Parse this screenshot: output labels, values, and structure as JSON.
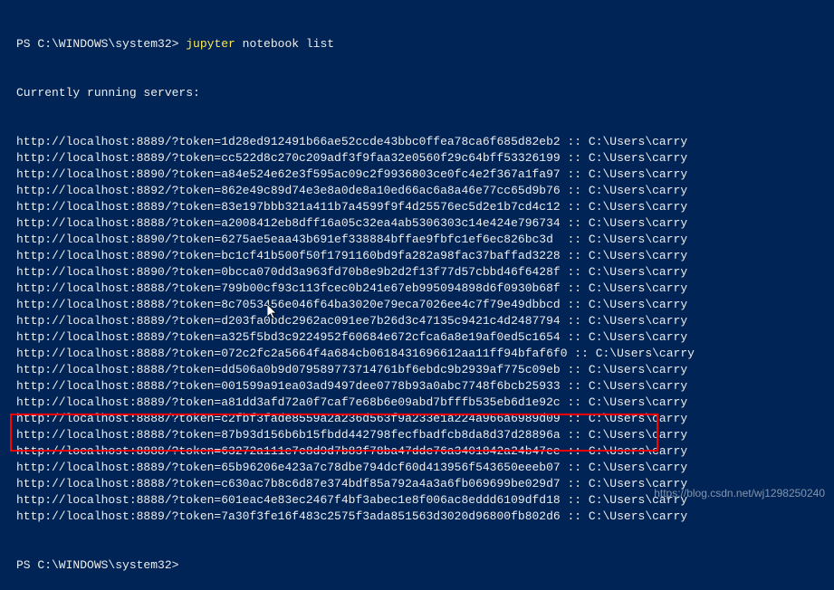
{
  "prompt": {
    "prefix": "PS C:\\WINDOWS\\system32> ",
    "command_name": "jupyter",
    "command_args": " notebook list"
  },
  "header": "Currently running servers:",
  "servers": [
    {
      "port": "8889",
      "token": "1d28ed912491b66ae52ccde43bbc0ffea78ca6f685d82eb2",
      "path": "C:\\Users\\carry"
    },
    {
      "port": "8889",
      "token": "cc522d8c270c209adf3f9faa32e0560f29c64bff53326199",
      "path": "C:\\Users\\carry"
    },
    {
      "port": "8890",
      "token": "a84e524e62e3f595ac09c2f9936803ce0fc4e2f367a1fa97",
      "path": "C:\\Users\\carry"
    },
    {
      "port": "8892",
      "token": "862e49c89d74e3e8a0de8a10ed66ac6a8a46e77cc65d9b76",
      "path": "C:\\Users\\carry"
    },
    {
      "port": "8889",
      "token": "83e197bbb321a411b7a4599f9f4d25576ec5d2e1b7cd4c12",
      "path": "C:\\Users\\carry"
    },
    {
      "port": "8888",
      "token": "a2008412eb8dff16a05c32ea4ab5306303c14e424e796734",
      "path": "C:\\Users\\carry"
    },
    {
      "port": "8890",
      "token": "6275ae5eaa43b691ef338884bffae9fbfc1ef6ec826bc3d ",
      "path": "C:\\Users\\carry"
    },
    {
      "port": "8890",
      "token": "bc1cf41b500f50f1791160bd9fa282a98fac37baffad3228",
      "path": "C:\\Users\\carry"
    },
    {
      "port": "8890",
      "token": "0bcca070dd3a963fd70b8e9b2d2f13f77d57cbbd46f6428f",
      "path": "C:\\Users\\carry"
    },
    {
      "port": "8888",
      "token": "799b00cf93c113fcec0b241e67eb995094898d6f0930b68f",
      "path": "C:\\Users\\carry"
    },
    {
      "port": "8888",
      "token": "8c7053456e046f64ba3020e79eca7026ee4c7f79e49dbbcd",
      "path": "C:\\Users\\carry"
    },
    {
      "port": "8889",
      "token": "d203fa0bdc2962ac091ee7b26d3c47135c9421c4d2487794",
      "path": "C:\\Users\\carry"
    },
    {
      "port": "8889",
      "token": "a325f5bd3c9224952f60684e672cfca6a8e19af0ed5c1654",
      "path": "C:\\Users\\carry"
    },
    {
      "port": "8888",
      "token": "072c2fc2a5664f4a684cb0618431696612aa11ff94bfaf6f0",
      "path": "C:\\Users\\carry"
    },
    {
      "port": "8888",
      "token": "dd506a0b9d079589773714761bf6ebdc9b2939af775c09eb",
      "path": "C:\\Users\\carry"
    },
    {
      "port": "8888",
      "token": "001599a91ea03ad9497dee0778b93a0abc7748f6bcb25933",
      "path": "C:\\Users\\carry"
    },
    {
      "port": "8889",
      "token": "a81dd3afd72a0f7caf7e68b6e09abd7bfffb535eb6d1e92c",
      "path": "C:\\Users\\carry"
    },
    {
      "port": "8888",
      "token": "c2fbf3fade8559a2a236d563f9a233e1a224a966a6989d09",
      "path": "C:\\Users\\carry"
    },
    {
      "port": "8888",
      "token": "87b93d156b6b15fbdd442798fecfbadfcb8da8d37d28896a",
      "path": "C:\\Users\\carry"
    },
    {
      "port": "8888",
      "token": "63272a111e7c8d9d7b83f78ba47ddc76a3401842a24b47ee",
      "path": "C:\\Users\\carry"
    },
    {
      "port": "8889",
      "token": "65b96206e423a7c78dbe794dcf60d413956f543650eeeb07",
      "path": "C:\\Users\\carry"
    },
    {
      "port": "8888",
      "token": "c630ac7b8c6d87e374bdf85a792a4a3a6fb069699be029d7",
      "path": "C:\\Users\\carry"
    },
    {
      "port": "8888",
      "token": "601eac4e83ec2467f4bf3abec1e8f006ac8eddd6109dfd18",
      "path": "C:\\Users\\carry"
    },
    {
      "port": "8889",
      "token": "7a30f3fe16f483c2575f3ada851563d3020d96800fb802d6",
      "path": "C:\\Users\\carry"
    }
  ],
  "prompt_end": "PS C:\\WINDOWS\\system32>",
  "watermark": "https://blog.csdn.net/wj1298250240"
}
